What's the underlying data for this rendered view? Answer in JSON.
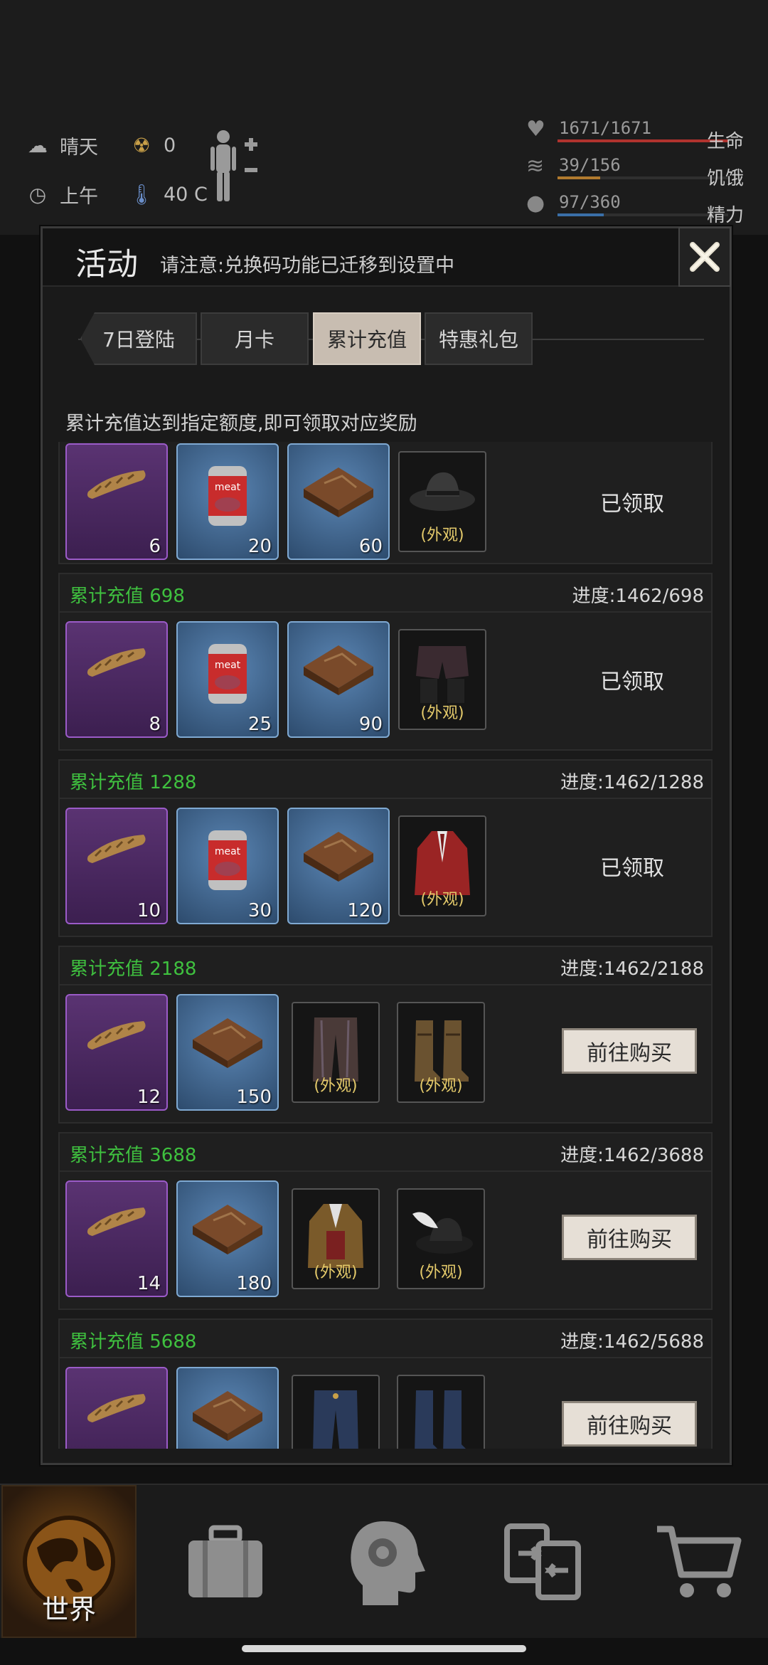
{
  "hud": {
    "weather": "晴天",
    "radiation": "0",
    "time_of_day": "上午",
    "temperature": "40 C",
    "stats": [
      {
        "name": "health",
        "value": "1671/1671",
        "label": "生命",
        "fill": 1.0,
        "color": "#b0332e"
      },
      {
        "name": "hunger",
        "value": "39/156",
        "label": "饥饿",
        "fill": 0.25,
        "color": "#b07a2e"
      },
      {
        "name": "energy",
        "value": "97/360",
        "label": "精力",
        "fill": 0.27,
        "color": "#3a6fa8"
      }
    ]
  },
  "modal": {
    "title": "活动",
    "notice": "请注意:兑换码功能已迁移到设置中",
    "tabs": [
      "7日登陆",
      "月卡",
      "累计充值",
      "特惠礼包"
    ],
    "active_tab": 2,
    "description": "累计充值达到指定额度,即可领取对应奖励",
    "look_label": "(外观)",
    "tiers": [
      {
        "title": "",
        "progress": "",
        "items": [
          {
            "type": "purple",
            "qty": "6"
          },
          {
            "type": "blue-can",
            "qty": "20"
          },
          {
            "type": "blue-box",
            "qty": "60"
          },
          {
            "type": "hat",
            "qty": ""
          }
        ],
        "status": "已领取"
      },
      {
        "title": "累计充值 698",
        "progress": "进度:1462/698",
        "items": [
          {
            "type": "purple",
            "qty": "8"
          },
          {
            "type": "blue-can",
            "qty": "25"
          },
          {
            "type": "blue-box",
            "qty": "90"
          },
          {
            "type": "shorts",
            "qty": ""
          }
        ],
        "status": "已领取"
      },
      {
        "title": "累计充值 1288",
        "progress": "进度:1462/1288",
        "items": [
          {
            "type": "purple",
            "qty": "10"
          },
          {
            "type": "blue-can",
            "qty": "30"
          },
          {
            "type": "blue-box",
            "qty": "120"
          },
          {
            "type": "coat",
            "qty": ""
          }
        ],
        "status": "已领取"
      },
      {
        "title": "累计充值 2188",
        "progress": "进度:1462/2188",
        "items": [
          {
            "type": "purple",
            "qty": "12"
          },
          {
            "type": "blue-box",
            "qty": "150"
          },
          {
            "type": "pants",
            "qty": ""
          },
          {
            "type": "boots",
            "qty": ""
          }
        ],
        "status": "前往购买"
      },
      {
        "title": "累计充值 3688",
        "progress": "进度:1462/3688",
        "items": [
          {
            "type": "purple",
            "qty": "14"
          },
          {
            "type": "blue-box",
            "qty": "180"
          },
          {
            "type": "jacket",
            "qty": ""
          },
          {
            "type": "feather-hat",
            "qty": ""
          }
        ],
        "status": "前往购买"
      },
      {
        "title": "累计充值 5688",
        "progress": "进度:1462/5688",
        "items": [
          {
            "type": "purple",
            "qty": ""
          },
          {
            "type": "blue-box",
            "qty": ""
          },
          {
            "type": "jeans",
            "qty": ""
          },
          {
            "type": "blue-boots",
            "qty": ""
          }
        ],
        "status": "前往购买"
      }
    ]
  },
  "nav": {
    "items": [
      {
        "name": "world",
        "label": "世界",
        "icon": "globe-icon"
      },
      {
        "name": "inventory",
        "label": "",
        "icon": "suitcase-icon"
      },
      {
        "name": "skills",
        "label": "",
        "icon": "head-gear-icon"
      },
      {
        "name": "trade",
        "label": "",
        "icon": "exchange-icon"
      },
      {
        "name": "shop",
        "label": "",
        "icon": "cart-icon"
      }
    ],
    "active": 0
  }
}
